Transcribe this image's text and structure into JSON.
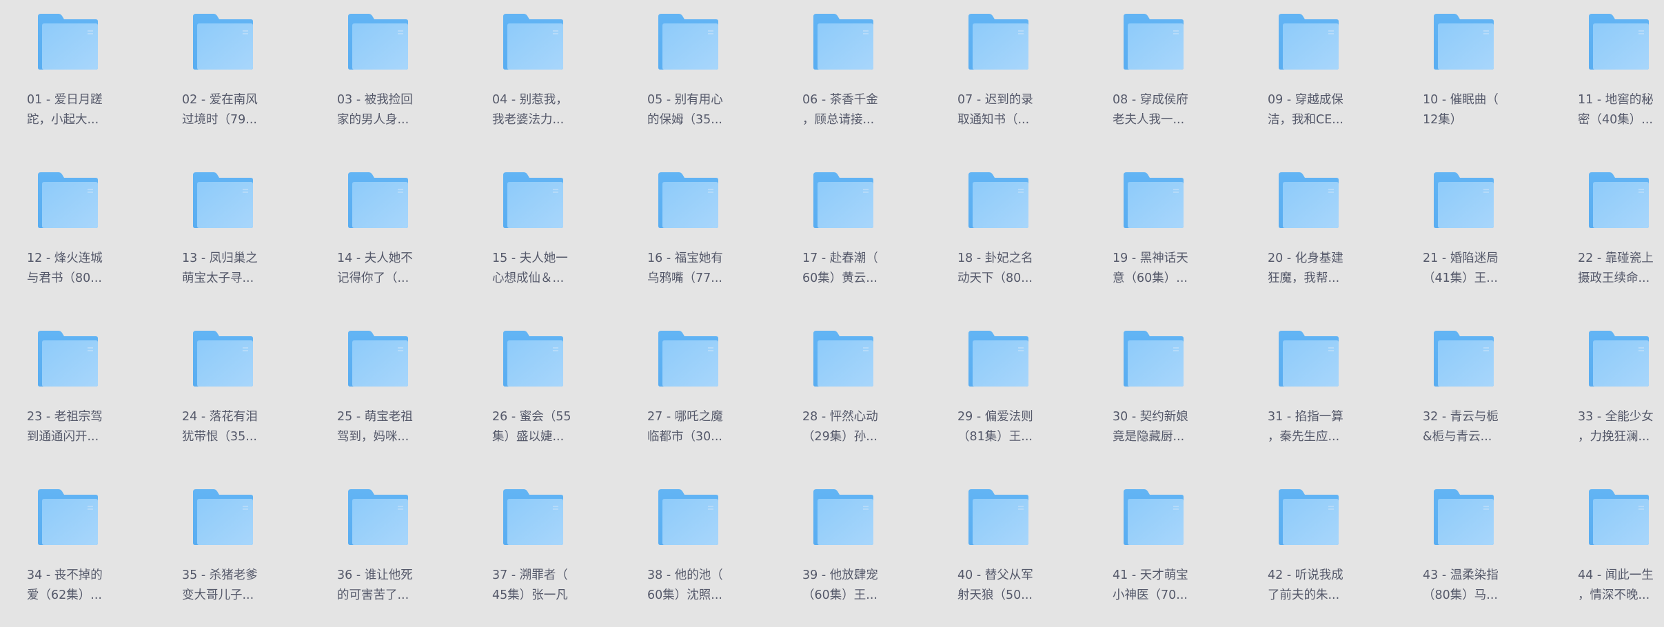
{
  "items": [
    {
      "line1": "01 - 爱日月蹉",
      "line2": "跎，小起大..."
    },
    {
      "line1": "02 - 爱在南风",
      "line2": "过境时（79..."
    },
    {
      "line1": "03 - 被我捡回",
      "line2": "家的男人身..."
    },
    {
      "line1": "04 - 别惹我，",
      "line2": "我老婆法力..."
    },
    {
      "line1": "05 - 别有用心",
      "line2": "的保姆（35..."
    },
    {
      "line1": "06 - 茶香千金",
      "line2": "，顾总请接..."
    },
    {
      "line1": "07 - 迟到的录",
      "line2": "取通知书（..."
    },
    {
      "line1": "08 - 穿成侯府",
      "line2": "老夫人我一..."
    },
    {
      "line1": "09 - 穿越成保",
      "line2": "洁，我和CE..."
    },
    {
      "line1": "10 - 催眠曲（",
      "line2": "12集）"
    },
    {
      "line1": "11 - 地窖的秘",
      "line2": "密（40集）..."
    },
    {
      "line1": "12 - 烽火连城",
      "line2": "与君书（80..."
    },
    {
      "line1": "13 - 凤归巢之",
      "line2": "萌宝太子寻..."
    },
    {
      "line1": "14 - 夫人她不",
      "line2": "记得你了（..."
    },
    {
      "line1": "15 - 夫人她一",
      "line2": "心想成仙＆..."
    },
    {
      "line1": "16 - 福宝她有",
      "line2": "乌鸦嘴（77..."
    },
    {
      "line1": "17 - 赴春潮（",
      "line2": "60集）黄云..."
    },
    {
      "line1": "18 - 卦妃之名",
      "line2": "动天下（80..."
    },
    {
      "line1": "19 - 黑神话天",
      "line2": "意（60集）..."
    },
    {
      "line1": "20 - 化身基建",
      "line2": "狂魔，我帮..."
    },
    {
      "line1": "21 - 婚陷迷局",
      "line2": "（41集）王..."
    },
    {
      "line1": "22 - 靠碰瓷上",
      "line2": "摄政王续命..."
    },
    {
      "line1": "23 - 老祖宗驾",
      "line2": "到通通闪开..."
    },
    {
      "line1": "24 - 落花有泪",
      "line2": "犹带恨（35..."
    },
    {
      "line1": "25 - 萌宝老祖",
      "line2": "驾到，妈咪..."
    },
    {
      "line1": "26 - 蜜会（55",
      "line2": "集）盛以婕..."
    },
    {
      "line1": "27 - 哪吒之魔",
      "line2": "临都市（30..."
    },
    {
      "line1": "28 - 怦然心动",
      "line2": "（29集）孙..."
    },
    {
      "line1": "29 - 偏爱法则",
      "line2": "（81集）王..."
    },
    {
      "line1": "30 - 契约新娘",
      "line2": "竟是隐藏厨..."
    },
    {
      "line1": "31 - 掐指一算",
      "line2": "，秦先生应..."
    },
    {
      "line1": "32 - 青云与栀",
      "line2": "&栀与青云..."
    },
    {
      "line1": "33 - 全能少女",
      "line2": "，力挽狂澜..."
    },
    {
      "line1": "34 - 丧不掉的",
      "line2": "爱（62集）..."
    },
    {
      "line1": "35 - 杀猪老爹",
      "line2": "变大哥儿子..."
    },
    {
      "line1": "36 - 谁让他死",
      "line2": "的可害苦了..."
    },
    {
      "line1": "37 - 溯罪者（",
      "line2": "45集）张一凡"
    },
    {
      "line1": "38 - 他的池（",
      "line2": "60集）沈照..."
    },
    {
      "line1": "39 - 他放肆宠",
      "line2": "（60集）王..."
    },
    {
      "line1": "40 - 替父从军",
      "line2": "射天狼（50..."
    },
    {
      "line1": "41 - 天才萌宝",
      "line2": "小神医（70..."
    },
    {
      "line1": "42 - 听说我成",
      "line2": "了前夫的朱..."
    },
    {
      "line1": "43 - 温柔染指",
      "line2": "（80集）马..."
    },
    {
      "line1": "44 - 闻此一生",
      "line2": "，情深不晚..."
    }
  ]
}
